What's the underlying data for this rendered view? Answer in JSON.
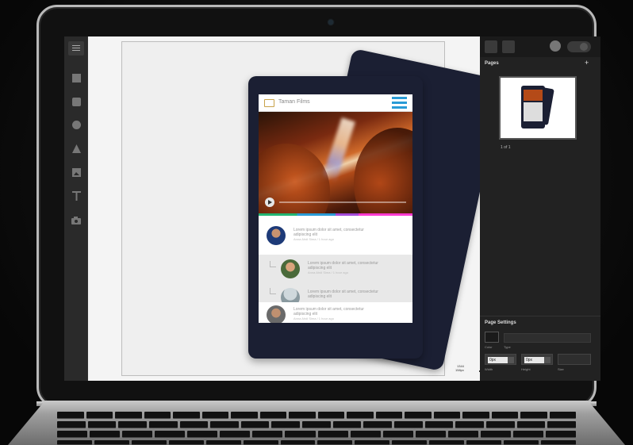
{
  "app": {
    "brand": "Taman Films",
    "posts": [
      {
        "line1": "Lorem ipsum dolor sit amet, consectetur",
        "line2": "adipiscing elit",
        "line3": "Anna Ahdi  Sima / 1 hour ago"
      },
      {
        "line1": "Lorem ipsum dolor sit amet, consectetur",
        "line2": "adipiscing elit",
        "line3": "Anna Ahdi  Sima / 1 hour ago"
      },
      {
        "line1": "Lorem ipsum dolor sit amet, consectetur",
        "line2": "adipiscing elit",
        "line3": ""
      },
      {
        "line1": "Lorem ipsum dolor sit amet, consectetur",
        "line2": "adipiscing elit",
        "line3": "Anna Ahdi  Sima / 1 hour ago"
      }
    ]
  },
  "tools": [
    "menu-icon",
    "rectangle-icon",
    "rounded-rectangle-icon",
    "circle-icon",
    "triangle-icon",
    "image-icon",
    "text-icon",
    "camera-icon"
  ],
  "right_panel": {
    "pages_label": "Pages",
    "add_label": "+",
    "page_count": "1 of 1",
    "page_settings_label": "Page Settings",
    "color_label": "Color",
    "type_label": "Type",
    "width_label": "Width",
    "height_label": "Height",
    "size_label": "Size",
    "width_value": "0px",
    "height_value": "0px"
  },
  "zoom": {
    "value": "1344",
    "unit": "158px"
  },
  "colors": {
    "accent": "#2a9bd6",
    "device": "#1b1f33",
    "panel": "#222222"
  }
}
